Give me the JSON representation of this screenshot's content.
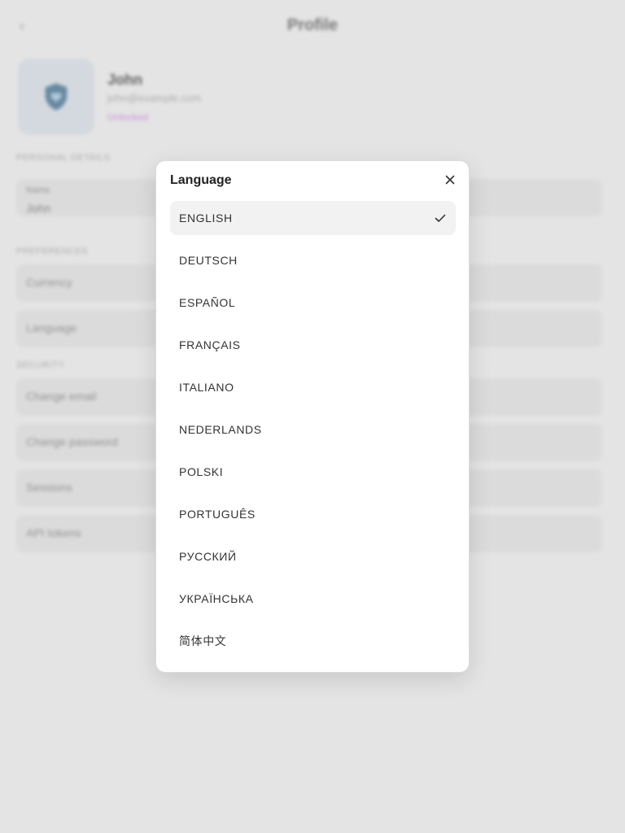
{
  "background": {
    "title": "Profile",
    "user": {
      "name": "John",
      "email": "john@example.com",
      "badge": "Unlocked"
    },
    "sections": {
      "personal": "Personal Details",
      "preferences": "Preferences",
      "security": "Security"
    },
    "name_field": {
      "label": "Name",
      "value": "John"
    },
    "preference_items": [
      "Currency",
      "Language"
    ],
    "security_items": [
      "Change email",
      "Change password",
      "Sessions",
      "API tokens"
    ]
  },
  "modal": {
    "title": "Language",
    "selected": "ENGLISH",
    "languages": [
      "ENGLISH",
      "DEUTSCH",
      "ESPAÑOL",
      "FRANÇAIS",
      "ITALIANO",
      "NEDERLANDS",
      "POLSKI",
      "PORTUGUÊS",
      "РУССКИЙ",
      "УКРАЇНСЬКА",
      "简体中文"
    ]
  },
  "icons": {
    "close": "close-icon",
    "check": "check-icon",
    "back": "chevron-left-icon",
    "avatar": "shield-heart-icon"
  },
  "colors": {
    "backdrop": "#e4e4e4",
    "selected_bg": "#f2f2f2",
    "badge": "#c36fd8"
  }
}
